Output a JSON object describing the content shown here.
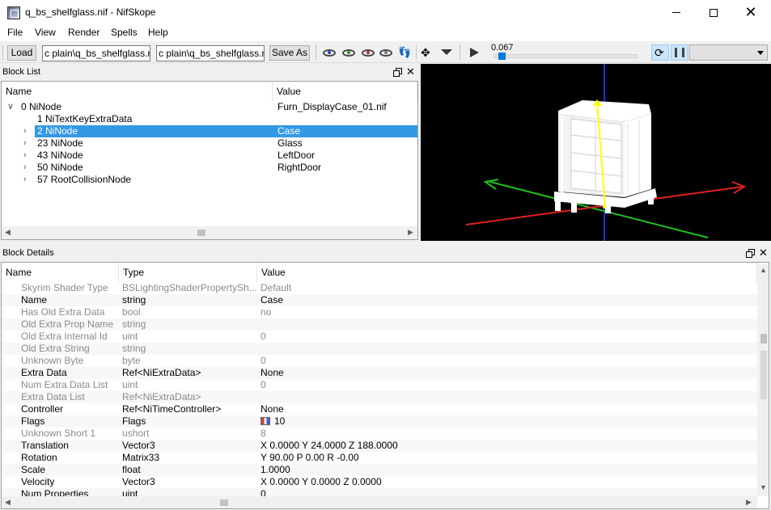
{
  "window": {
    "title": "q_bs_shelfglass.nif - NifSkope"
  },
  "menu": [
    "File",
    "View",
    "Render",
    "Spells",
    "Help"
  ],
  "toolbar": {
    "load_label": "Load",
    "load_path": "c plain\\q_bs_shelfglass.nif",
    "save_path": "c plain\\q_bs_shelfglass.nif",
    "save_as_label": "Save As",
    "time_value": "0.067",
    "timeline_position": 0.03
  },
  "block_list": {
    "title": "Block List",
    "columns": [
      "Name",
      "Value"
    ],
    "rows": [
      {
        "chevron": "∨",
        "name": "0 NiNode",
        "value": "Furn_DisplayCase_01.nif",
        "indent": 0,
        "selected": false
      },
      {
        "chevron": "",
        "name": "1 NiTextKeyExtraData",
        "value": "",
        "indent": 1,
        "selected": false
      },
      {
        "chevron": "›",
        "name": "2 NiNode",
        "value": "Case",
        "indent": 1,
        "selected": true
      },
      {
        "chevron": "›",
        "name": "23 NiNode",
        "value": "Glass",
        "indent": 1,
        "selected": false
      },
      {
        "chevron": "›",
        "name": "43 NiNode",
        "value": "LeftDoor",
        "indent": 1,
        "selected": false
      },
      {
        "chevron": "›",
        "name": "50 NiNode",
        "value": "RightDoor",
        "indent": 1,
        "selected": false
      },
      {
        "chevron": "›",
        "name": "57 RootCollisionNode",
        "value": "",
        "indent": 1,
        "selected": false
      }
    ]
  },
  "block_details": {
    "title": "Block Details",
    "columns": [
      "Name",
      "Type",
      "Value"
    ],
    "rows": [
      {
        "name": "Skyrim Shader Type",
        "type": "BSLightingShaderPropertySh...",
        "value": "Default",
        "disabled": true
      },
      {
        "name": "Name",
        "type": "string",
        "value": "Case",
        "disabled": false
      },
      {
        "name": "Has Old Extra Data",
        "type": "bool",
        "value": "no",
        "disabled": true
      },
      {
        "name": "Old Extra Prop Name",
        "type": "string",
        "value": "",
        "disabled": true
      },
      {
        "name": "Old Extra Internal Id",
        "type": "uint",
        "value": "0",
        "disabled": true
      },
      {
        "name": "Old Extra String",
        "type": "string",
        "value": "",
        "disabled": true
      },
      {
        "name": "Unknown Byte",
        "type": "byte",
        "value": "0",
        "disabled": true
      },
      {
        "name": "Extra Data",
        "type": "Ref<NiExtraData>",
        "value": "None",
        "disabled": false
      },
      {
        "name": "Num Extra Data List",
        "type": "uint",
        "value": "0",
        "disabled": true
      },
      {
        "name": "Extra Data List",
        "type": "Ref<NiExtraData>",
        "value": "",
        "disabled": true
      },
      {
        "name": "Controller",
        "type": "Ref<NiTimeController>",
        "value": "None",
        "disabled": false
      },
      {
        "name": "Flags",
        "type": "Flags",
        "value": "10",
        "disabled": false,
        "flag": true
      },
      {
        "name": "Unknown Short 1",
        "type": "ushort",
        "value": "8",
        "disabled": true
      },
      {
        "name": "Translation",
        "type": "Vector3",
        "value": "X 0.0000 Y 24.0000 Z 188.0000",
        "disabled": false
      },
      {
        "name": "Rotation",
        "type": "Matrix33",
        "value": "Y 90.00 P 0.00 R -0.00",
        "disabled": false
      },
      {
        "name": "Scale",
        "type": "float",
        "value": "1.0000",
        "disabled": false
      },
      {
        "name": "Velocity",
        "type": "Vector3",
        "value": "X 0.0000 Y 0.0000 Z 0.0000",
        "disabled": false
      },
      {
        "name": "Num Properties",
        "type": "uint",
        "value": "0",
        "disabled": false
      }
    ]
  },
  "colors": {
    "selection": "#3399e6",
    "axis_x": "#e02020",
    "axis_y": "#20c020",
    "axis_z": "#2030e0",
    "highlight_bone": "#ffff00"
  }
}
